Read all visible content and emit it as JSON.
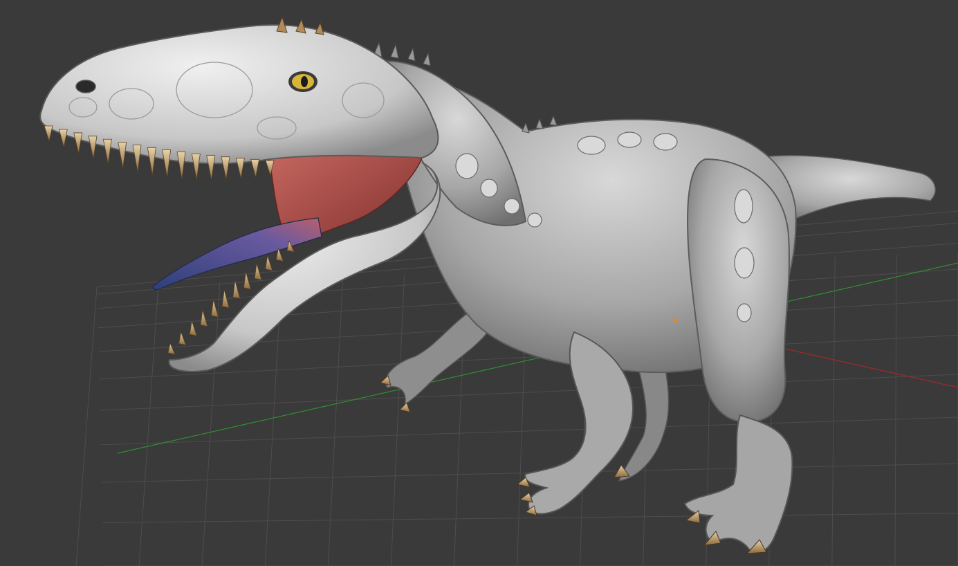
{
  "viewport": {
    "background": "#3a3a3a",
    "grid_color": "#4d4d4d",
    "axis_x_color": "#9b2a2a",
    "axis_y_color": "#2f8f2f",
    "origin_marker_color": "#e08a28"
  },
  "model": {
    "subject": "dinosaur-sculpt",
    "skin_color": "#bdbdbd",
    "mouth_color": "#a9473f",
    "tongue_color": "#3f4f86",
    "teeth_color": "#c8a97a",
    "eye_color": "#d7b43a"
  }
}
